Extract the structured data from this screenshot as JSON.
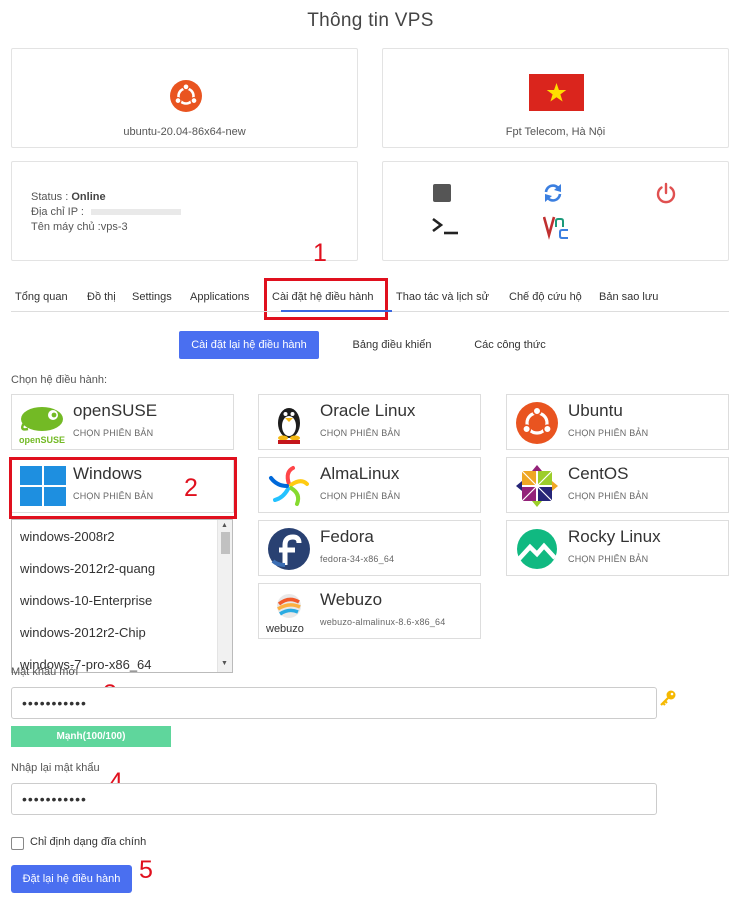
{
  "page_title": "Thông tin VPS",
  "os_card": {
    "logo": "ubuntu-logo",
    "caption": "ubuntu-20.04-86x64-new"
  },
  "location_card": {
    "flag": "vietnam-flag",
    "caption": "Fpt Telecom, Hà Nội"
  },
  "status_card": {
    "status_label": "Status : ",
    "status_value": "Online",
    "ip_label": "Địa chỉ IP : ",
    "hostname_label": "Tên máy chủ :",
    "hostname_value": "vps-3"
  },
  "actions": [
    {
      "name": "stop-icon",
      "color": "#555555"
    },
    {
      "name": "restart-icon",
      "color": "#3b7fe0"
    },
    {
      "name": "power-icon",
      "color": "#e05050"
    },
    {
      "name": "console-icon",
      "color": "#222222"
    },
    {
      "name": "vnc-icon",
      "color": "#c03030"
    }
  ],
  "annotations": {
    "s1": "1",
    "s2": "2",
    "s3": "3",
    "s4": "4",
    "s5": "5",
    "color": "#e0101e"
  },
  "tabs": [
    {
      "label": "Tổng quan"
    },
    {
      "label": "Đồ thị"
    },
    {
      "label": "Settings"
    },
    {
      "label": "Applications"
    },
    {
      "label": "Cài đặt hệ điều hành",
      "active": true
    },
    {
      "label": "Thao tác và lịch sử"
    },
    {
      "label": "Chế độ cứu hộ"
    },
    {
      "label": "Bản sao lưu"
    }
  ],
  "subtabs": [
    {
      "label": "Cài đặt lại hệ điều hành",
      "active": true
    },
    {
      "label": "Bảng điều khiển"
    },
    {
      "label": "Các công thức"
    }
  ],
  "choose_os_label": "Chọn hệ điều hành:",
  "os_list": [
    {
      "name": "openSUSE",
      "sub": "CHỌN PHIÊN BẢN",
      "icon": "opensuse-logo"
    },
    {
      "name": "Oracle Linux",
      "sub": "CHỌN PHIÊN BẢN",
      "icon": "oracle-linux-logo"
    },
    {
      "name": "Ubuntu",
      "sub": "CHỌN PHIÊN BẢN",
      "icon": "ubuntu-logo"
    },
    {
      "name": "Windows",
      "sub": "CHỌN PHIÊN BẢN",
      "icon": "windows-logo"
    },
    {
      "name": "AlmaLinux",
      "sub": "CHỌN PHIÊN BẢN",
      "icon": "almalinux-logo"
    },
    {
      "name": "CentOS",
      "sub": "CHỌN PHIÊN BẢN",
      "icon": "centos-logo"
    },
    {
      "name": "Fedora",
      "sub": "fedora-34-x86_64",
      "icon": "fedora-logo"
    },
    {
      "name": "Rocky Linux",
      "sub": "CHỌN PHIÊN BẢN",
      "icon": "rocky-linux-logo"
    },
    {
      "name": "Webuzo",
      "sub": "webuzo-almalinux-8.6-x86_64",
      "icon": "webuzo-logo",
      "logo_text": "webuzo"
    }
  ],
  "windows_versions": [
    "windows-2008r2",
    "windows-2012r2-quang",
    "windows-10-Enterprise",
    "windows-2012r2-Chip",
    "windows-7-pro-x86_64"
  ],
  "password": {
    "label": "Mật khẩu mới",
    "value": "•••••••••••",
    "strength": "Mạnh(100/100)",
    "strength_color": "#5fd69c"
  },
  "confirm_password": {
    "label": "Nhập lại mật khẩu",
    "value": "•••••••••••"
  },
  "format_disk_label": "Chỉ định dạng đĩa chính",
  "submit_label": "Đặt lại hệ điều hành",
  "accent_color": "#4a6ff0"
}
